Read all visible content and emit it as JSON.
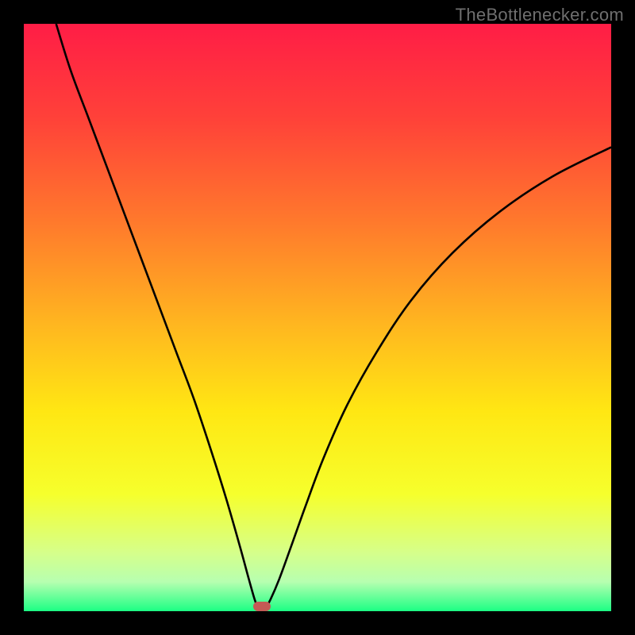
{
  "watermark": "TheBottlenecker.com",
  "chart_data": {
    "type": "line",
    "title": "",
    "xlabel": "",
    "ylabel": "",
    "xlim": [
      0,
      100
    ],
    "ylim": [
      0,
      100
    ],
    "gradient_stops": [
      {
        "pos": 0,
        "color": "#ff1d46"
      },
      {
        "pos": 16,
        "color": "#ff4139"
      },
      {
        "pos": 34,
        "color": "#ff7a2c"
      },
      {
        "pos": 52,
        "color": "#ffb91f"
      },
      {
        "pos": 66,
        "color": "#ffe713"
      },
      {
        "pos": 80,
        "color": "#f6ff2c"
      },
      {
        "pos": 90,
        "color": "#d6ff8a"
      },
      {
        "pos": 95,
        "color": "#b7ffb0"
      },
      {
        "pos": 100,
        "color": "#1cff84"
      }
    ],
    "series": [
      {
        "name": "bottleneck-left",
        "stroke": "#000000",
        "stroke_width": 2.6,
        "x": [
          5.5,
          8,
          11,
          14,
          17,
          20,
          23,
          26,
          29,
          32,
          34.5,
          36.8,
          38.3,
          39.3,
          40.0
        ],
        "y": [
          100,
          92,
          84,
          76,
          68,
          60,
          52,
          44,
          36,
          27,
          19,
          11,
          5.5,
          2.0,
          0.2
        ]
      },
      {
        "name": "bottleneck-right",
        "stroke": "#000000",
        "stroke_width": 2.6,
        "x": [
          41.0,
          42.0,
          43.5,
          45.5,
          48,
          51,
          55,
          60,
          66,
          73,
          81,
          90,
          100
        ],
        "y": [
          0.2,
          2.0,
          5.5,
          11,
          18,
          26,
          35,
          44,
          53,
          61,
          68,
          74,
          79
        ]
      }
    ],
    "marker": {
      "x": 40.5,
      "y": 0.8,
      "color": "#c45a55"
    }
  }
}
